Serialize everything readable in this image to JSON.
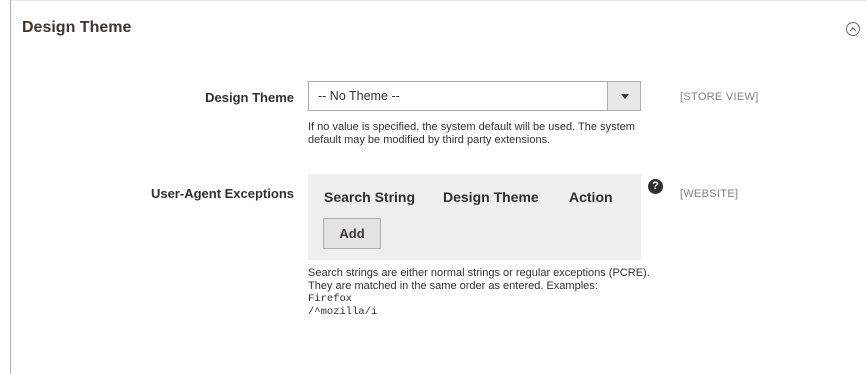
{
  "section": {
    "title": "Design Theme",
    "collapse_icon": "chevron-up-icon"
  },
  "design_theme": {
    "label": "Design Theme",
    "selected_value": "-- No Theme --",
    "scope": "[STORE VIEW]",
    "note": "If no value is specified, the system default will be used. The system default may be modified by third party extensions."
  },
  "user_agent": {
    "label": "User-Agent Exceptions",
    "columns": [
      "Search String",
      "Design Theme",
      "Action"
    ],
    "add_label": "Add",
    "help_icon": "question-mark-icon",
    "help_glyph": "?",
    "scope": "[WEBSITE]",
    "note": "Search strings are either normal strings or regular exceptions (PCRE). They are matched in the same order as entered. Examples:",
    "examples": [
      "Firefox",
      "/^mozilla/i"
    ]
  }
}
